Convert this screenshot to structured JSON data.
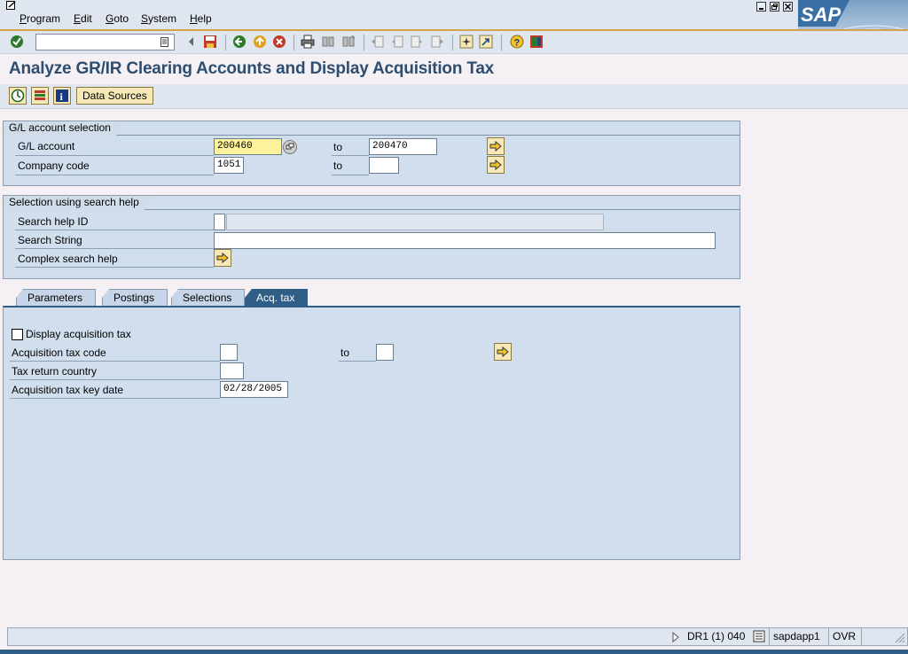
{
  "menubar": {
    "items": [
      {
        "label": "Program",
        "u": "P",
        "rest": "rogram"
      },
      {
        "label": "Edit",
        "u": "E",
        "rest": "dit"
      },
      {
        "label": "Goto",
        "u": "G",
        "rest": "oto"
      },
      {
        "label": "System",
        "u": "S",
        "rest": "ystem"
      },
      {
        "label": "Help",
        "u": "H",
        "rest": "elp"
      }
    ]
  },
  "toolbar": {
    "command_field_value": "",
    "icons": [
      "enter-icon",
      "save-icon",
      "back-icon",
      "exit-icon",
      "cancel-icon",
      "print-icon",
      "find-icon",
      "find-next-icon",
      "first-page-icon",
      "previous-page-icon",
      "next-page-icon",
      "last-page-icon",
      "create-session-icon",
      "shortcut-icon",
      "help-icon",
      "customize-layout-icon"
    ]
  },
  "page": {
    "title": "Analyze GR/IR Clearing Accounts and Display Acquisition Tax"
  },
  "app_toolbar": {
    "data_sources_label": "Data Sources",
    "icons": [
      "execute-icon",
      "selection-options-icon",
      "information-icon"
    ]
  },
  "gl_selection": {
    "title": "G/L account selection",
    "gl_account_label": "G/L account",
    "gl_account_from": "200460",
    "gl_account_to": "200470",
    "company_code_label": "Company code",
    "company_code_from": "1051",
    "company_code_to": "",
    "to_label": "to"
  },
  "search_help": {
    "title": "Selection using search help",
    "search_help_id_label": "Search help ID",
    "search_help_id_value": "",
    "search_string_label": "Search String",
    "search_string_value": "",
    "complex_search_label": "Complex search help"
  },
  "tabs": [
    {
      "label": "Parameters",
      "active": false
    },
    {
      "label": "Postings",
      "active": false
    },
    {
      "label": "Selections",
      "active": false
    },
    {
      "label": "Acq. tax",
      "active": true
    }
  ],
  "acq_tax": {
    "display_checkbox_label": "Display acquisition tax",
    "display_checked": false,
    "tax_code_label": "Acquisition tax code",
    "tax_code_from": "",
    "tax_code_to": "",
    "to_label": "to",
    "country_label": "Tax return country",
    "country_value": "",
    "key_date_label": "Acquisition tax key date",
    "key_date_value": "02/28/2005"
  },
  "statusbar": {
    "system": "DR1 (1) 040",
    "server": "sapdapp1",
    "mode": "OVR"
  },
  "colors": {
    "accent": "#2f5f86",
    "title": "#2d4e70",
    "required_field": "#fdf29a",
    "frame_bg": "#d1deed"
  }
}
